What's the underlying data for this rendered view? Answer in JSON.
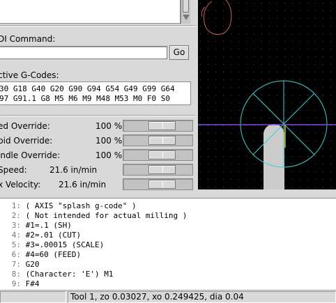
{
  "mdi": {
    "label": "DI Command:",
    "value": "",
    "go_label": "Go"
  },
  "active_gcodes": {
    "label": "ctive G-Codes:",
    "line1": "30 G18 G40 G20 G90 G94 G54 G49 G99 G64",
    "line2": "97 G91.1 G8 M5 M6 M9 M48 M53 M0 F0 S0"
  },
  "overrides": [
    {
      "label": "ed Override:",
      "value": "100 %",
      "fraction": 0.62
    },
    {
      "label": "pid Override:",
      "value": "100 %",
      "fraction": 0.62
    },
    {
      "label": "indle Override:",
      "value": "100 %",
      "fraction": 0.62
    },
    {
      "label": " Speed:",
      "value": "21.6 in/min",
      "fraction": 0.62
    },
    {
      "label": "x Velocity:",
      "value": "21.6 in/min",
      "fraction": 0.62
    }
  ],
  "code_lines": [
    {
      "n": "1:",
      "text": "( AXIS \"splash g-code\" )"
    },
    {
      "n": "2:",
      "text": "( Not intended for actual milling )"
    },
    {
      "n": "3:",
      "text": "#1=.1 (SH)"
    },
    {
      "n": "4:",
      "text": "#2=.01 (CUT)"
    },
    {
      "n": "5:",
      "text": "#3=.00015 (SCALE)"
    },
    {
      "n": "6:",
      "text": "#4=60 (FEED)"
    },
    {
      "n": "7:",
      "text": "G20"
    },
    {
      "n": "8:",
      "text": "(Character: 'E') M1"
    },
    {
      "n": "9:",
      "text": "F#4"
    }
  ],
  "status": {
    "left": "",
    "right": "Tool 1, zo 0.03027, xo 0.249425, dia 0.04"
  },
  "colors": {
    "grid": "#4a4a4a",
    "toolpath": "#c86464",
    "tool_circle": "#40d0d0",
    "x_axis": "#8a4ad8",
    "y_axis": "#c8c830",
    "tool_body": "#cccccc"
  },
  "icons": {
    "scroll_down": "triangle-down-icon"
  }
}
